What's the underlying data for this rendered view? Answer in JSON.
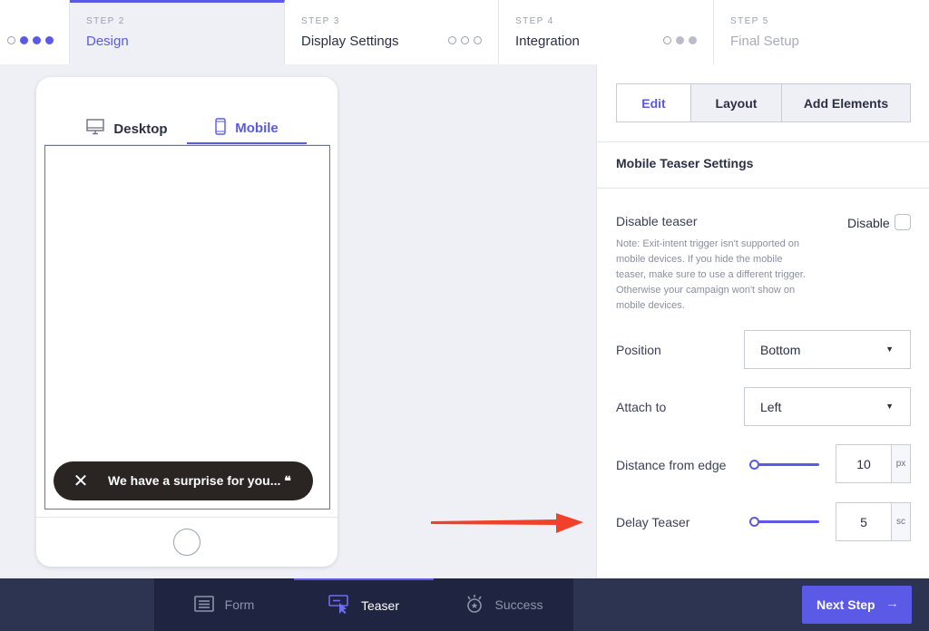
{
  "stepper": {
    "steps": [
      {
        "num": "",
        "title": "",
        "state": "done"
      },
      {
        "num": "STEP 2",
        "title": "Design",
        "state": "active"
      },
      {
        "num": "STEP 3",
        "title": "Display Settings",
        "state": "todo"
      },
      {
        "num": "STEP 4",
        "title": "Integration",
        "state": "partial"
      },
      {
        "num": "STEP 5",
        "title": "Final Setup",
        "state": "disabled"
      }
    ]
  },
  "preview": {
    "tabs": [
      {
        "label": "Desktop",
        "icon": "desktop-icon"
      },
      {
        "label": "Mobile",
        "icon": "mobile-icon",
        "active": true
      }
    ],
    "teaser": {
      "close": "✕",
      "text": "We have a surprise for you... ❝"
    }
  },
  "panel": {
    "segments": [
      "Edit",
      "Layout",
      "Add Elements"
    ],
    "active_segment": "Edit",
    "section_title": "Mobile Teaser Settings",
    "disable_teaser": {
      "label": "Disable teaser",
      "checkbox_label": "Disable",
      "checked": false,
      "note": "Note: Exit-intent trigger isn't supported on mobile devices. If you hide the mobile teaser, make sure to use a different trigger. Otherwise your campaign won't show on mobile devices."
    },
    "position": {
      "label": "Position",
      "value": "Bottom"
    },
    "attach_to": {
      "label": "Attach to",
      "value": "Left"
    },
    "distance": {
      "label": "Distance from edge",
      "value": "10",
      "unit": "px"
    },
    "delay": {
      "label": "Delay Teaser",
      "value": "5",
      "unit": "sc"
    }
  },
  "bottombar": {
    "tabs": [
      {
        "label": "Form",
        "icon": "form-icon"
      },
      {
        "label": "Teaser",
        "icon": "teaser-icon",
        "active": true
      },
      {
        "label": "Success",
        "icon": "success-icon"
      }
    ],
    "next_label": "Next Step",
    "next_arrow": "→"
  },
  "colors": {
    "accent": "#5a5ae6",
    "bar": "#2c3452",
    "annotation_arrow": "#f0412a"
  }
}
